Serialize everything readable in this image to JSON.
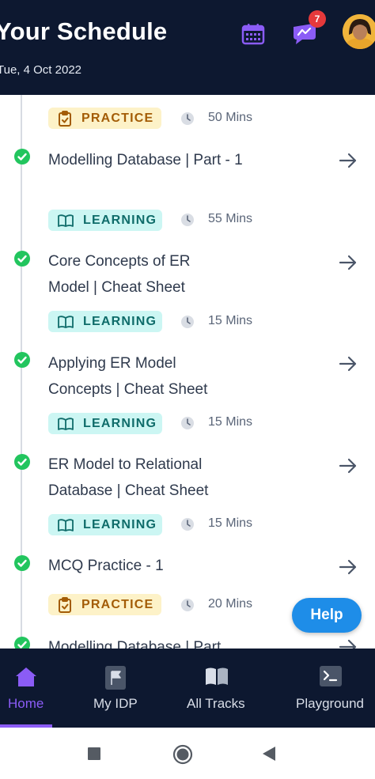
{
  "header": {
    "title": "Your Schedule",
    "date": "Tue, 4 Oct 2022",
    "notification_count": "7",
    "icons": [
      "calendar-icon",
      "chat-notification-icon",
      "avatar"
    ]
  },
  "items": [
    {
      "title": "",
      "tag": "PRACTICE",
      "tag_type": "practice",
      "duration": "50 Mins",
      "completed": true
    },
    {
      "title": "Modelling Database | Part - 1",
      "tag": "LEARNING",
      "tag_type": "learning",
      "duration": "55 Mins",
      "completed": true
    },
    {
      "title": "Core Concepts of ER Model | Cheat Sheet",
      "tag": "LEARNING",
      "tag_type": "learning",
      "duration": "15 Mins",
      "completed": true
    },
    {
      "title": "Applying ER Model Concepts | Cheat Sheet",
      "tag": "LEARNING",
      "tag_type": "learning",
      "duration": "15 Mins",
      "completed": true
    },
    {
      "title": "ER Model to Relational Database | Cheat Sheet",
      "tag": "LEARNING",
      "tag_type": "learning",
      "duration": "15 Mins",
      "completed": true
    },
    {
      "title": "MCQ Practice - 1",
      "tag": "PRACTICE",
      "tag_type": "practice",
      "duration": "20 Mins",
      "completed": true
    },
    {
      "title": "Modelling Database | Part",
      "completed": true
    }
  ],
  "help_button": "Help",
  "nav": {
    "items": [
      {
        "label": "Home",
        "icon": "home-icon",
        "active": true
      },
      {
        "label": "My IDP",
        "icon": "flag-icon",
        "active": false
      },
      {
        "label": "All Tracks",
        "icon": "book-icon",
        "active": false
      },
      {
        "label": "Playground",
        "icon": "terminal-icon",
        "active": false
      }
    ]
  },
  "colors": {
    "header_bg": "#0d1830",
    "accent_purple": "#8b5cf6",
    "learning_bg": "#ccf6f3",
    "practice_bg": "#fdf2c8",
    "check_green": "#22c55e",
    "help_blue": "#1e8de8",
    "badge_red": "#e5393b"
  }
}
